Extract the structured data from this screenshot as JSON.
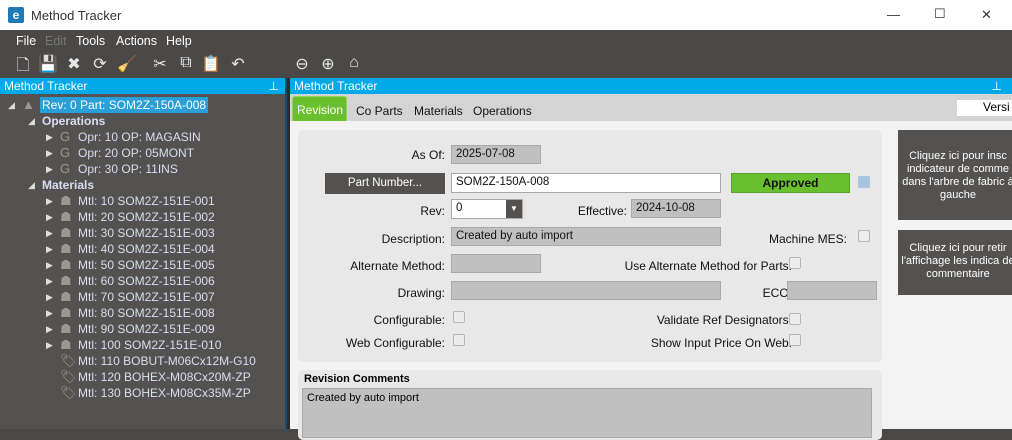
{
  "window": {
    "title": "Method Tracker",
    "minimize": "—",
    "maximize": "☐",
    "close": "✕"
  },
  "menu": [
    "File",
    "Edit",
    "Tools",
    "Actions",
    "Help"
  ],
  "toolbar": {
    "icons": [
      "new-icon",
      "save-icon",
      "delete-icon",
      "refresh-icon",
      "clear-icon",
      "cut-icon",
      "copy-icon",
      "paste-icon",
      "undo-icon",
      "back-icon",
      "forward-icon",
      "home-icon"
    ],
    "glyphs": [
      "🗋",
      "💾",
      "✖",
      "⟳",
      "🧹",
      "✂",
      "⧉",
      "📋",
      "↶",
      "⊖",
      "⊕",
      "⌂"
    ]
  },
  "left_panel": {
    "title": "Method Tracker",
    "pin": "⊥",
    "root": "Rev: 0 Part: SOM2Z-150A-008",
    "operations_label": "Operations",
    "operations": [
      "Opr: 10 OP: MAGASIN",
      "Opr: 20 OP: 05MONT",
      "Opr: 30 OP: 11INS"
    ],
    "materials_label": "Materials",
    "materials": [
      {
        "label": "Mtl: 10 SOM2Z-151E-001",
        "assembly": true
      },
      {
        "label": "Mtl: 20 SOM2Z-151E-002",
        "assembly": true
      },
      {
        "label": "Mtl: 30 SOM2Z-151E-003",
        "assembly": true
      },
      {
        "label": "Mtl: 40 SOM2Z-151E-004",
        "assembly": true
      },
      {
        "label": "Mtl: 50 SOM2Z-151E-005",
        "assembly": true
      },
      {
        "label": "Mtl: 60 SOM2Z-151E-006",
        "assembly": true
      },
      {
        "label": "Mtl: 70 SOM2Z-151E-007",
        "assembly": true
      },
      {
        "label": "Mtl: 80 SOM2Z-151E-008",
        "assembly": true
      },
      {
        "label": "Mtl: 90 SOM2Z-151E-009",
        "assembly": true
      },
      {
        "label": "Mtl: 100 SOM2Z-151E-010",
        "assembly": true
      },
      {
        "label": "Mtl: 110 BOBUT-M06Cx12M-G10",
        "assembly": false
      },
      {
        "label": "Mtl: 120 BOHEX-M08Cx20M-ZP",
        "assembly": false
      },
      {
        "label": "Mtl: 130 BOHEX-M08Cx35M-ZP",
        "assembly": false
      }
    ]
  },
  "right_panel": {
    "title": "Method Tracker",
    "pin": "⊥",
    "tabs": [
      "Revision",
      "Co Parts",
      "Materials",
      "Operations"
    ],
    "version_label": "Versi",
    "form": {
      "as_of_label": "As Of:",
      "as_of": "2025-07-08",
      "part_button": "Part Number...",
      "part": "SOM2Z-150A-008",
      "status": "Approved",
      "rev_label": "Rev:",
      "rev": "0",
      "effective_label": "Effective:",
      "effective": "2024-10-08",
      "description_label": "Description:",
      "description": "Created by auto import",
      "machine_mes_label": "Machine MES:",
      "alt_method_label": "Alternate Method:",
      "use_alt_label": "Use Alternate Method for Parts:",
      "drawing_label": "Drawing:",
      "eco_label": "ECO:",
      "configurable_label": "Configurable:",
      "validate_ref_label": "Validate Ref Designators:",
      "web_config_label": "Web Configurable:",
      "show_price_label": "Show Input Price On Web:"
    },
    "comments": {
      "title": "Revision Comments",
      "text": "Created by auto import"
    },
    "side_buttons": [
      "Cliquez ici pour insc indicateur de comme dans l'arbre de fabric à gauche",
      "Cliquez ici pour retir l'affichage les indica de commentaire"
    ]
  },
  "colors": {
    "accent": "#00a9e8",
    "approved": "#6abf2f",
    "tab_active": "#6abf2f"
  }
}
